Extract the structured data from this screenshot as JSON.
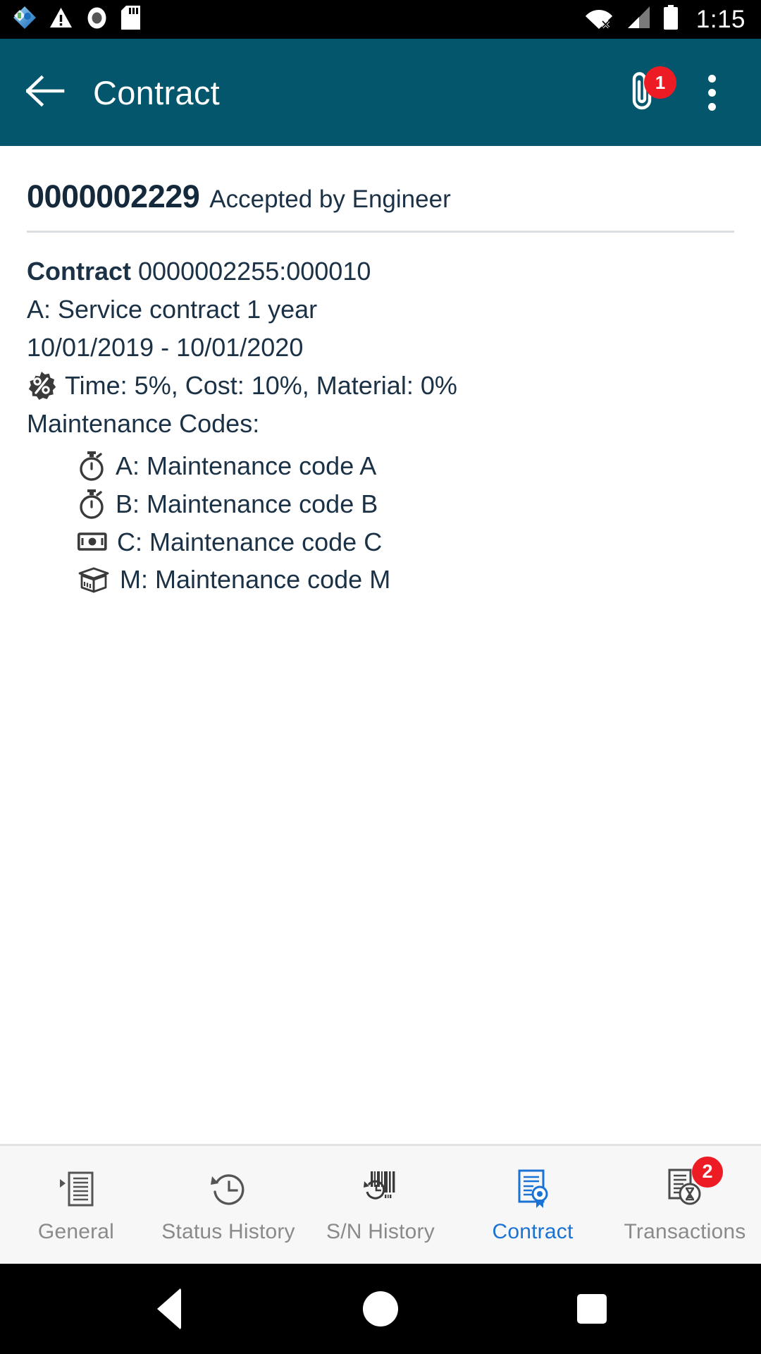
{
  "status_bar": {
    "time": "1:15",
    "left_icons": [
      "app-sync-icon",
      "warning-triangle-icon",
      "record-dot-icon",
      "sd-card-icon"
    ],
    "right_icons": [
      "wifi-no-internet-icon",
      "cellular-signal-icon",
      "battery-full-icon"
    ]
  },
  "app_bar": {
    "title": "Contract",
    "back_icon": "arrow-left-icon",
    "attachment_icon": "paperclip-icon",
    "attachment_badge": "1",
    "overflow_icon": "more-vertical-icon",
    "bg_color": "#03566B"
  },
  "document": {
    "number": "0000002229",
    "status": "Accepted by Engineer"
  },
  "details": {
    "contract_label": "Contract",
    "contract_value": " 0000002255:000010",
    "description": "A: Service contract 1 year",
    "date_range": "10/01/2019 - 10/01/2020",
    "percent_icon": "percent-badge-icon",
    "percentages": "Time: 5%, Cost: 10%, Material: 0%",
    "maintenance_codes_label": "Maintenance Codes:",
    "maintenance_codes": [
      {
        "icon": "stopwatch-icon",
        "label": "A: Maintenance code A"
      },
      {
        "icon": "stopwatch-icon",
        "label": "B: Maintenance code B"
      },
      {
        "icon": "banknote-icon",
        "label": "C: Maintenance code C"
      },
      {
        "icon": "open-box-icon",
        "label": "M: Maintenance code M"
      }
    ]
  },
  "bottom_nav": {
    "active_color": "#1A73D4",
    "inactive_color": "#8A8A8A",
    "items": [
      {
        "label": "General",
        "icon": "document-general-icon",
        "active": false,
        "badge": null
      },
      {
        "label": "Status History",
        "icon": "clock-history-icon",
        "active": false,
        "badge": null
      },
      {
        "label": "S/N History",
        "icon": "barcode-history-icon",
        "active": false,
        "badge": null
      },
      {
        "label": "Contract",
        "icon": "contract-seal-icon",
        "active": true,
        "badge": null
      },
      {
        "label": "Transactions",
        "icon": "document-hourglass-icon",
        "active": false,
        "badge": "2"
      }
    ]
  },
  "system_nav": {
    "back": "back-triangle-icon",
    "home": "home-circle-icon",
    "recents": "recents-square-icon"
  }
}
